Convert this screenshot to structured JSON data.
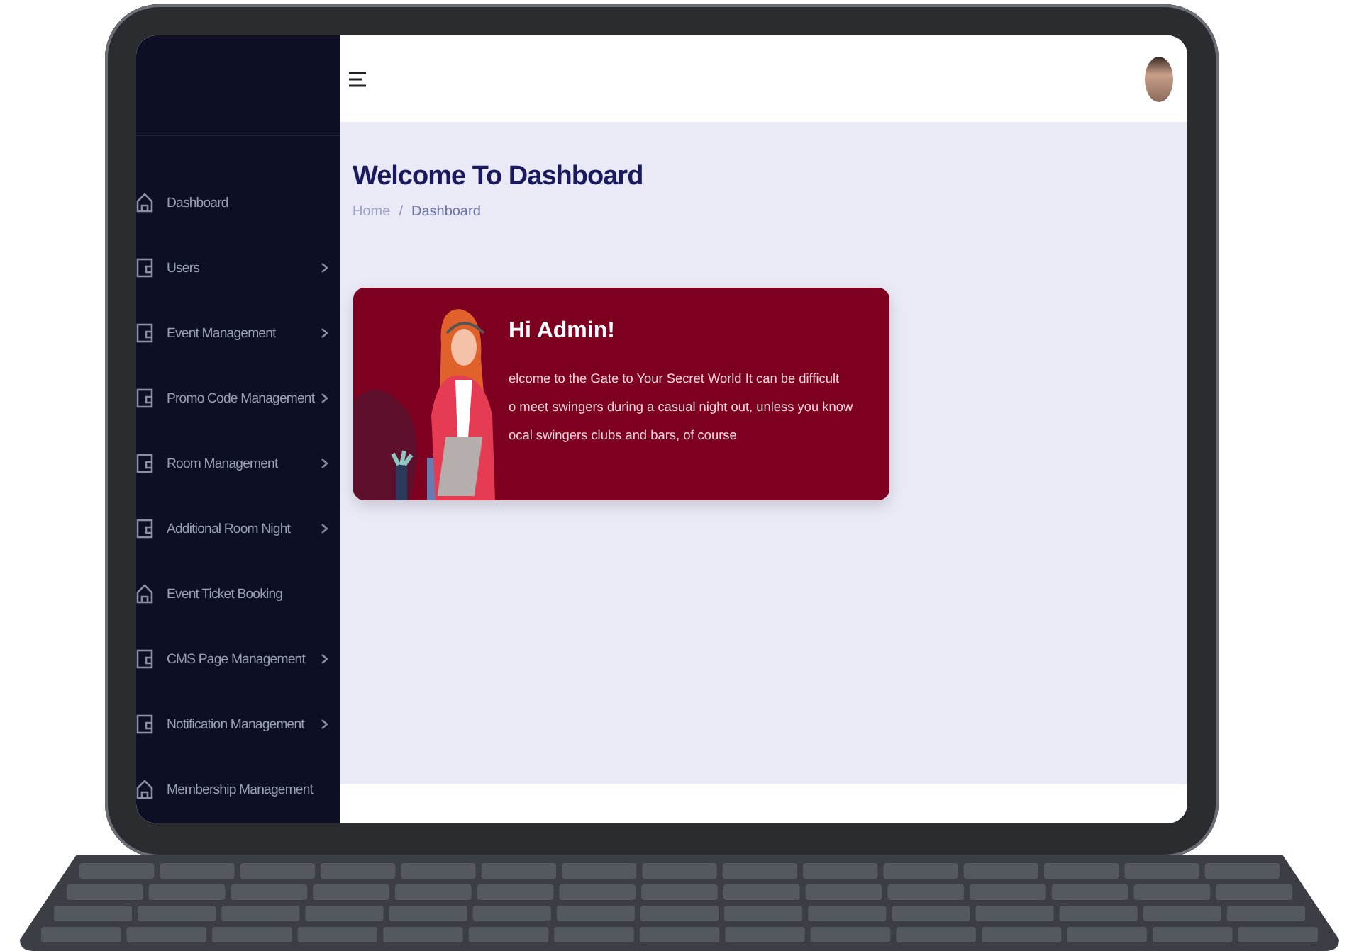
{
  "sidebar": {
    "items": [
      {
        "label": "Dashboard",
        "kind": "home",
        "has_submenu": false
      },
      {
        "label": "Users",
        "kind": "card",
        "has_submenu": true
      },
      {
        "label": "Event Management",
        "kind": "card",
        "has_submenu": true
      },
      {
        "label": "Promo Code Management",
        "kind": "card",
        "has_submenu": true
      },
      {
        "label": "Room Management",
        "kind": "card",
        "has_submenu": true
      },
      {
        "label": "Additional Room Night",
        "kind": "card",
        "has_submenu": true
      },
      {
        "label": "Event Ticket Booking",
        "kind": "home",
        "has_submenu": false
      },
      {
        "label": "CMS Page Management",
        "kind": "card",
        "has_submenu": true
      },
      {
        "label": "Notification Management",
        "kind": "card",
        "has_submenu": true
      },
      {
        "label": "Membership Management",
        "kind": "home",
        "has_submenu": false
      }
    ]
  },
  "page": {
    "title": "Welcome To Dashboard",
    "breadcrumb": [
      "Home",
      "Dashboard"
    ],
    "breadcrumb_separator": "/"
  },
  "welcome_card": {
    "heading": "Hi Admin!",
    "lines": [
      "elcome to the Gate to Your Secret World It can be difficult",
      "o meet swingers during a casual night out, unless you know",
      "ocal swingers clubs and bars, of course"
    ]
  }
}
